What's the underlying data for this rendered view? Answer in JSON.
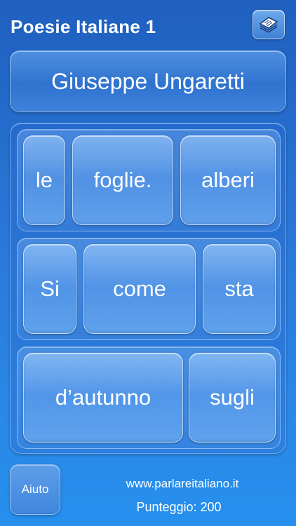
{
  "header": {
    "title": "Poesie Italiane 1",
    "menu_icon": "book-stack-icon"
  },
  "poet": {
    "name": "Giuseppe Ungaretti"
  },
  "puzzle": {
    "rows": [
      {
        "tiles": [
          {
            "word": "le"
          },
          {
            "word": "foglie."
          },
          {
            "word": "alberi"
          }
        ]
      },
      {
        "tiles": [
          {
            "word": "Si"
          },
          {
            "word": "come"
          },
          {
            "word": "sta"
          }
        ]
      },
      {
        "tiles": [
          {
            "word": "d’autunno"
          },
          {
            "word": "sugli"
          }
        ]
      }
    ]
  },
  "footer": {
    "help_label": "Aiuto",
    "website": "www.parlareitaliano.it",
    "score_label": "Punteggio: 200"
  }
}
